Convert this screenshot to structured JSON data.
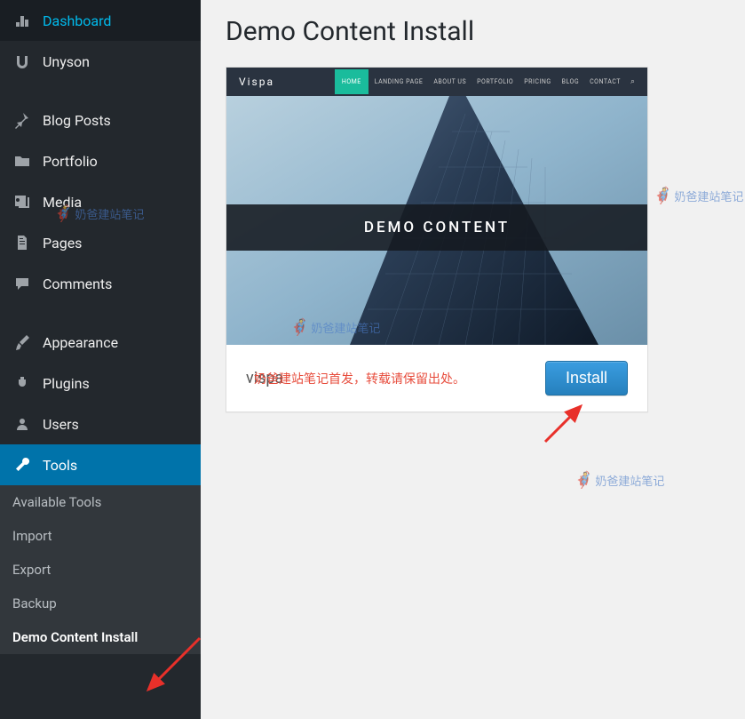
{
  "page": {
    "title": "Demo Content Install"
  },
  "sidebar": {
    "items": [
      {
        "label": "Dashboard",
        "icon": "dashboard"
      },
      {
        "label": "Unyson",
        "icon": "unyson"
      },
      {
        "label": "Blog Posts",
        "icon": "pin"
      },
      {
        "label": "Portfolio",
        "icon": "folder"
      },
      {
        "label": "Media",
        "icon": "media"
      },
      {
        "label": "Pages",
        "icon": "pages"
      },
      {
        "label": "Comments",
        "icon": "comment"
      },
      {
        "label": "Appearance",
        "icon": "brush"
      },
      {
        "label": "Plugins",
        "icon": "plug"
      },
      {
        "label": "Users",
        "icon": "user"
      },
      {
        "label": "Tools",
        "icon": "wrench",
        "active": true
      }
    ],
    "submenu": [
      {
        "label": "Available Tools"
      },
      {
        "label": "Import"
      },
      {
        "label": "Export"
      },
      {
        "label": "Backup"
      },
      {
        "label": "Demo Content Install",
        "current": true
      }
    ]
  },
  "demo": {
    "preview_logo": "Vispa",
    "nav": [
      "HOME",
      "LANDING PAGE",
      "ABOUT US",
      "PORTFOLIO",
      "PRICING",
      "BLOG",
      "CONTACT"
    ],
    "band_text": "DEMO CONTENT",
    "name": "vispa",
    "install_label": "Install"
  },
  "watermark": {
    "text": "奶爸建站笔记"
  },
  "overlay": {
    "text": "奶爸建站笔记首发，转载请保留出处。"
  }
}
